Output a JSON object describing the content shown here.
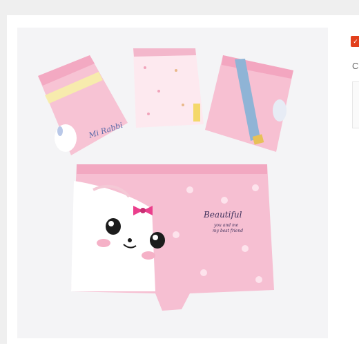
{
  "product_image": {
    "print_text": "Beautiful",
    "print_subtext_1": "you and me",
    "print_subtext_2": "my best friend",
    "small_pack_text": "Mi Rabbi"
  },
  "side_panel": {
    "badge_icon": "check-icon",
    "label": "C"
  },
  "colors": {
    "pink": "#f6bfd2",
    "light_pink": "#fde3ec",
    "hot_pink": "#ea3f8c",
    "badge_red": "#e2401c"
  }
}
